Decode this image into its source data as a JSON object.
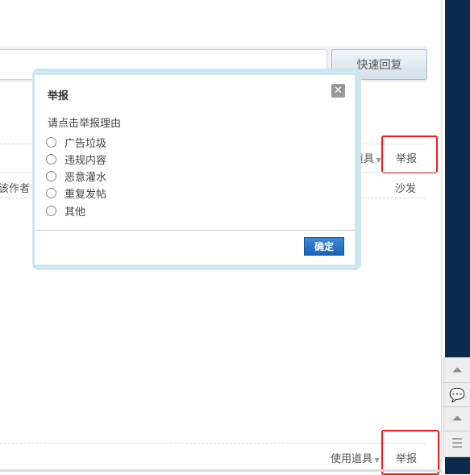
{
  "reply_box": {
    "button_label": "快速回复"
  },
  "post1": {
    "tools_label": "道具",
    "report_label": "举报",
    "author_label": "该作者",
    "floor_label": "沙发"
  },
  "post2": {
    "tools_label": "使用道具",
    "report_label": "举报"
  },
  "dialog": {
    "title": "举报",
    "prompt": "请点击举报理由",
    "options": [
      "广告垃圾",
      "违规内容",
      "恶意灌水",
      "重复发帖",
      "其他"
    ],
    "confirm_label": "确定",
    "close_icon": "close-icon"
  },
  "side_buttons": [
    "back-to-top-icon",
    "comment-icon",
    "back-to-top-icon",
    "list-icon"
  ],
  "colors": {
    "highlight": "#f01c1c",
    "sidebar": "#0c2a4d",
    "confirm": "#1b62b8"
  }
}
